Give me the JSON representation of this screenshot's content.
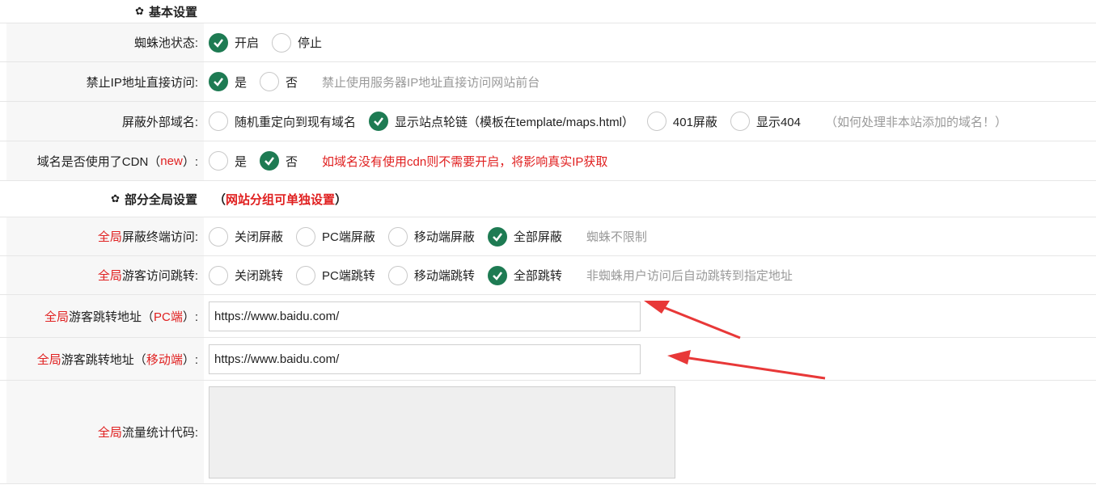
{
  "sections": {
    "basic": {
      "title": "基本设置"
    },
    "global": {
      "title": "部分全局设置",
      "note_open": "（",
      "note": "网站分组可单独设置",
      "note_close": "）"
    }
  },
  "rows": {
    "spider": {
      "label": "蜘蛛池状态:",
      "options": [
        "开启",
        "停止"
      ],
      "selected": 0
    },
    "ip_block": {
      "label": "禁止IP地址直接访问:",
      "options": [
        "是",
        "否"
      ],
      "selected": 0,
      "hint": "禁止使用服务器IP地址直接访问网站前台"
    },
    "external_domain": {
      "label": "屏蔽外部域名:",
      "options": [
        "随机重定向到现有域名",
        "显示站点轮链（模板在template/maps.html）",
        "401屏蔽",
        "显示404"
      ],
      "selected": 1,
      "hint": "（如何处理非本站添加的域名！）"
    },
    "cdn": {
      "label_pre": "域名是否使用了CDN（",
      "label_red": "new",
      "label_post": "）:",
      "options": [
        "是",
        "否"
      ],
      "selected": 1,
      "hint": "如域名没有使用cdn则不需要开启，将影响真实IP获取"
    },
    "terminal_block": {
      "label_red": "全局",
      "label": "屏蔽终端访问:",
      "options": [
        "关闭屏蔽",
        "PC端屏蔽",
        "移动端屏蔽",
        "全部屏蔽"
      ],
      "selected": 3,
      "hint": "蜘蛛不限制"
    },
    "visitor_jump": {
      "label_red": "全局",
      "label": "游客访问跳转:",
      "options": [
        "关闭跳转",
        "PC端跳转",
        "移动端跳转",
        "全部跳转"
      ],
      "selected": 3,
      "hint": "非蜘蛛用户访问后自动跳转到指定地址"
    },
    "jump_pc": {
      "label_red": "全局",
      "label_mid": "游客跳转地址（",
      "label_red2": "PC端",
      "label_post": "）:",
      "value": "https://www.baidu.com/"
    },
    "jump_mobile": {
      "label_red": "全局",
      "label_mid": "游客跳转地址（",
      "label_red2": "移动端",
      "label_post": "）:",
      "value": "https://www.baidu.com/"
    },
    "stats_code": {
      "label_red": "全局",
      "label": "流量统计代码:",
      "value": ""
    }
  },
  "colors": {
    "accent": "#1e7b53",
    "red": "#e02020",
    "hint": "#9a9a9a"
  }
}
